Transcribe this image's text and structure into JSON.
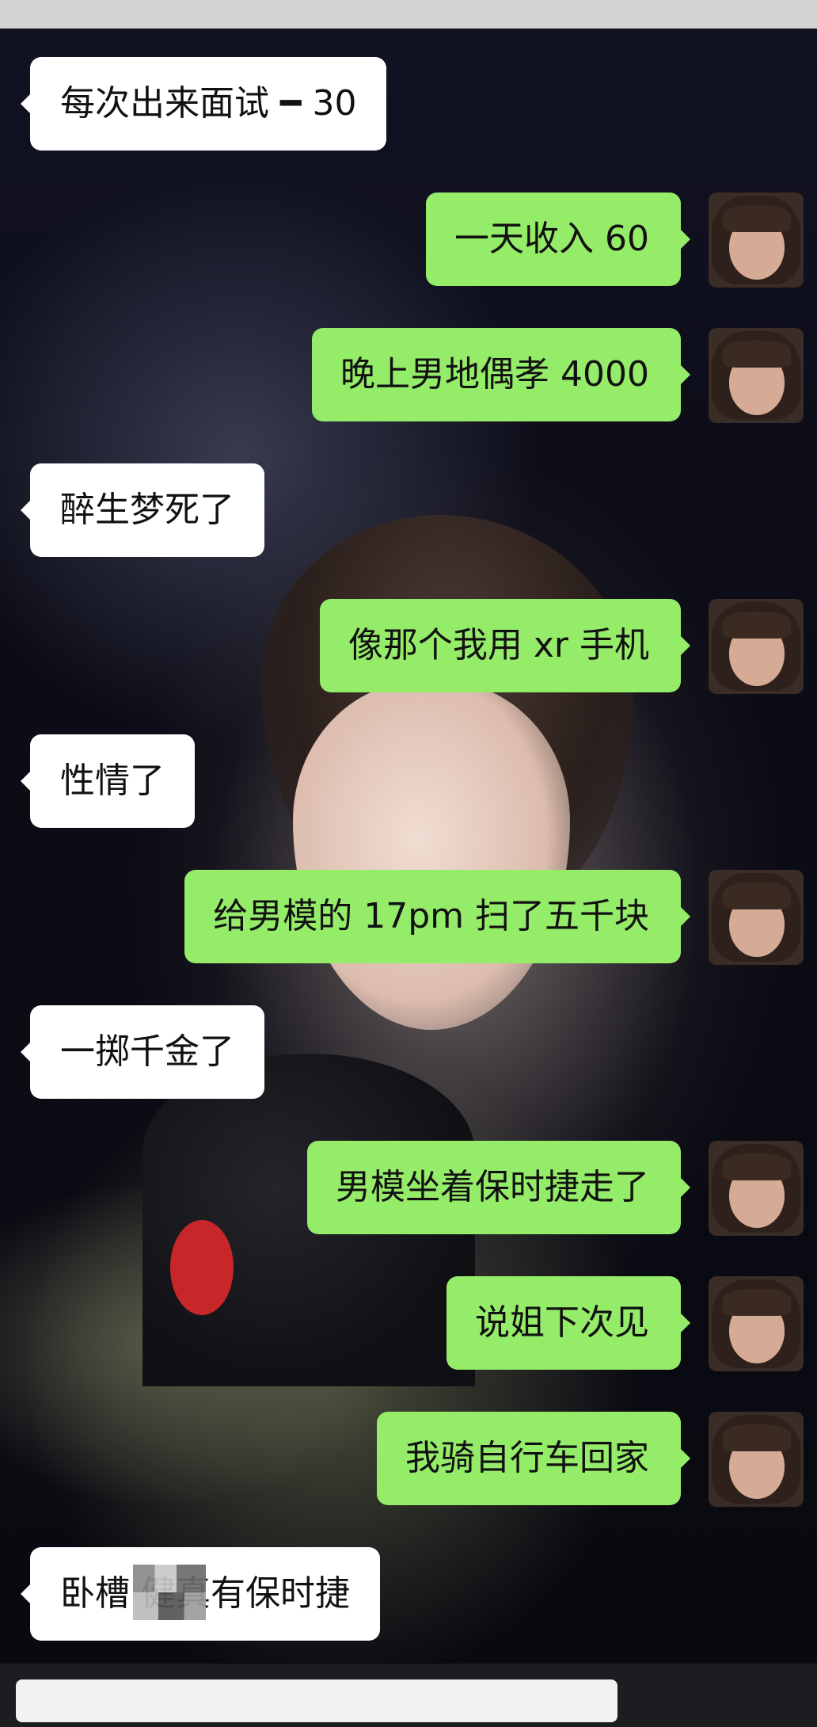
{
  "conversation": {
    "messages": [
      {
        "direction": "in",
        "text": "每次出来面试 ━ 30"
      },
      {
        "direction": "out",
        "text": "一天收入 60"
      },
      {
        "direction": "out",
        "text": "晚上男地偶孝 4000"
      },
      {
        "direction": "in",
        "text": "醉生梦死了"
      },
      {
        "direction": "out",
        "text": "像那个我用 xr 手机"
      },
      {
        "direction": "in",
        "text": "性情了"
      },
      {
        "direction": "out",
        "text": "给男模的 17pm 扫了五千块"
      },
      {
        "direction": "in",
        "text": "一掷千金了"
      },
      {
        "direction": "out",
        "text": "男模坐着保时捷走了"
      },
      {
        "direction": "out",
        "text": "说姐下次见"
      },
      {
        "direction": "out",
        "text": "我骑自行车回家"
      },
      {
        "direction": "in",
        "text": "卧槽   健真有保时捷"
      }
    ]
  },
  "colors": {
    "outgoing_bubble": "#95ec69",
    "incoming_bubble": "#ffffff",
    "text": "#111111"
  },
  "icons": {
    "avatar": "user-avatar-icon"
  }
}
